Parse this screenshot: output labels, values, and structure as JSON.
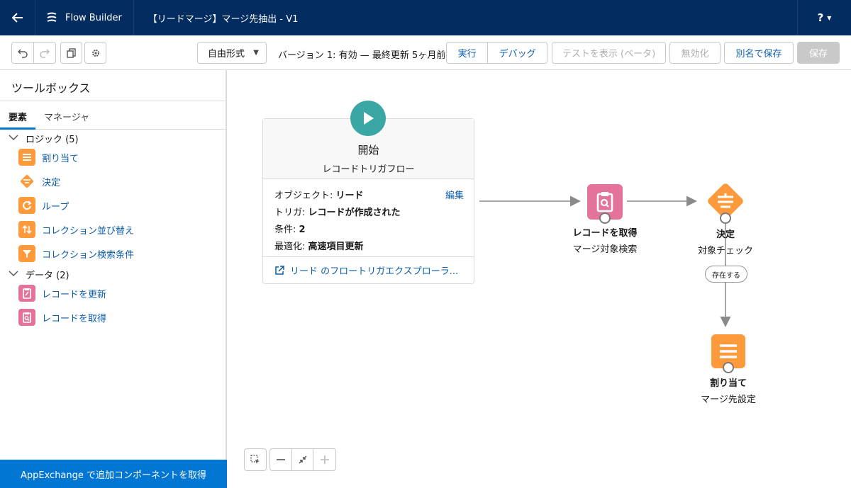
{
  "header": {
    "app_name": "Flow Builder",
    "flow_title": "【リードマージ】マージ先抽出 - V1",
    "help_label": "?"
  },
  "toolbar": {
    "layout_select": "自由形式",
    "version_status": "バージョン 1: 有効 — 最終更新 5ヶ月前",
    "run_label": "実行",
    "debug_label": "デバッグ",
    "test_label": "テストを表示 (ベータ)",
    "deactivate_label": "無効化",
    "save_as_label": "別名で保存",
    "save_label": "保存"
  },
  "sidebar": {
    "title": "ツールボックス",
    "tabs": [
      "要素",
      "マネージャ"
    ],
    "sections": [
      {
        "label": "ロジック (5)",
        "items": [
          {
            "label": "割り当て",
            "icon": "assignment-icon"
          },
          {
            "label": "決定",
            "icon": "decision-icon"
          },
          {
            "label": "ループ",
            "icon": "loop-icon"
          },
          {
            "label": "コレクション並び替え",
            "icon": "collection-sort-icon"
          },
          {
            "label": "コレクション検索条件",
            "icon": "collection-filter-icon"
          }
        ]
      },
      {
        "label": "データ (2)",
        "items": [
          {
            "label": "レコードを更新",
            "icon": "update-records-icon"
          },
          {
            "label": "レコードを取得",
            "icon": "get-records-icon"
          }
        ]
      }
    ],
    "appexchange_label": "AppExchange で追加コンポーネントを取得"
  },
  "canvas": {
    "start": {
      "title": "開始",
      "subtitle": "レコードトリガフロー",
      "edit_label": "編集",
      "rows": [
        {
          "key": "オブジェクト:",
          "value": "リード"
        },
        {
          "key": "トリガ:",
          "value": "レコードが作成された"
        },
        {
          "key": "条件:",
          "value": "2"
        },
        {
          "key": "最適化:",
          "value": "高速項目更新"
        }
      ],
      "explorer_link": "リード のフロートリガエクスプローラ..."
    },
    "get_records": {
      "type_label": "レコードを取得",
      "name": "マージ対象検索"
    },
    "decision": {
      "type_label": "決定",
      "name": "対象チェック",
      "outcome_label": "存在する"
    },
    "assignment": {
      "type_label": "割り当て",
      "name": "マージ先設定"
    }
  },
  "colors": {
    "header_bg": "#032d60",
    "brand_blue": "#0176d3",
    "link_blue": "#0b5cab",
    "logic_orange": "#ff9a3c",
    "data_pink": "#e3739b",
    "start_teal": "#3ba7a4"
  }
}
